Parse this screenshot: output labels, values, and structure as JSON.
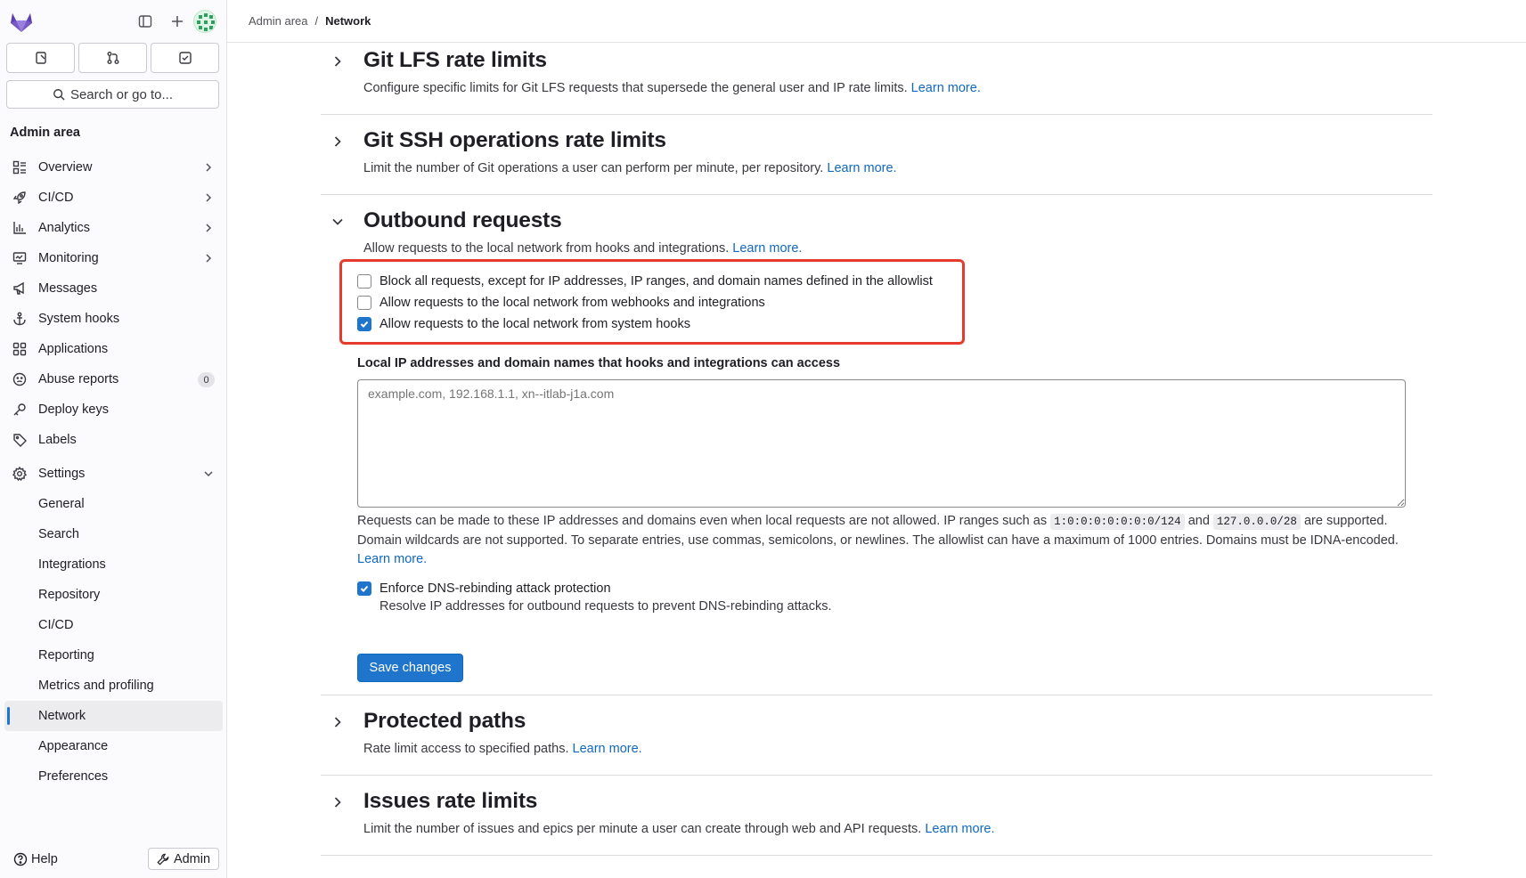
{
  "sidebar": {
    "section_title": "Admin area",
    "search_label": "Search or go to...",
    "nav": [
      {
        "label": "Overview",
        "icon": "overview-icon"
      },
      {
        "label": "CI/CD",
        "icon": "rocket-icon"
      },
      {
        "label": "Analytics",
        "icon": "chart-icon"
      },
      {
        "label": "Monitoring",
        "icon": "monitor-icon"
      },
      {
        "label": "Messages",
        "icon": "bullhorn-icon"
      },
      {
        "label": "System hooks",
        "icon": "anchor-icon"
      },
      {
        "label": "Applications",
        "icon": "applications-icon"
      },
      {
        "label": "Abuse reports",
        "icon": "abuse-icon",
        "badge": "0"
      },
      {
        "label": "Deploy keys",
        "icon": "key-icon"
      },
      {
        "label": "Labels",
        "icon": "label-icon"
      },
      {
        "label": "Settings",
        "icon": "gear-icon"
      }
    ],
    "settings_sub": [
      "General",
      "Search",
      "Integrations",
      "Repository",
      "CI/CD",
      "Reporting",
      "Metrics and profiling",
      "Network",
      "Appearance",
      "Preferences"
    ],
    "active_sub": "Network",
    "help_label": "Help",
    "admin_label": "Admin"
  },
  "breadcrumb": {
    "root": "Admin area",
    "separator": "/",
    "current": "Network"
  },
  "sections": {
    "lfs": {
      "title": "Git LFS rate limits",
      "desc": "Configure specific limits for Git LFS requests that supersede the general user and IP rate limits.",
      "link": "Learn more."
    },
    "ssh": {
      "title": "Git SSH operations rate limits",
      "desc": "Limit the number of Git operations a user can perform per minute, per repository.",
      "link": "Learn more."
    },
    "outbound": {
      "title": "Outbound requests",
      "desc": "Allow requests to the local network from hooks and integrations.",
      "link": "Learn more.",
      "checkboxes": [
        {
          "label": "Block all requests, except for IP addresses, IP ranges, and domain names defined in the allowlist",
          "checked": false
        },
        {
          "label": "Allow requests to the local network from webhooks and integrations",
          "checked": false
        },
        {
          "label": "Allow requests to the local network from system hooks",
          "checked": true
        }
      ],
      "allowlist_label": "Local IP addresses and domain names that hooks and integrations can access",
      "allowlist_placeholder": "example.com, 192.168.1.1, xn--itlab-j1a.com",
      "help_1": "Requests can be made to these IP addresses and domains even when local requests are not allowed. IP ranges such as",
      "code_1": "1:0:0:0:0:0:0:0/124",
      "help_and": "and",
      "code_2": "127.0.0.0/28",
      "help_2": "are supported. Domain wildcards are not supported. To separate entries, use commas, semicolons, or newlines. The allowlist can have a maximum of 1000 entries. Domains must be IDNA-encoded.",
      "help_link": "Learn more.",
      "dns_label": "Enforce DNS-rebinding attack protection",
      "dns_checked": true,
      "dns_help": "Resolve IP addresses for outbound requests to prevent DNS-rebinding attacks.",
      "save_label": "Save changes"
    },
    "protected": {
      "title": "Protected paths",
      "desc": "Rate limit access to specified paths.",
      "link": "Learn more."
    },
    "issues": {
      "title": "Issues rate limits",
      "desc": "Limit the number of issues and epics per minute a user can create through web and API requests.",
      "link": "Learn more."
    }
  },
  "colors": {
    "accent": "#1f75cb",
    "link": "#1068bf",
    "highlight_border": "#e53b2c"
  }
}
